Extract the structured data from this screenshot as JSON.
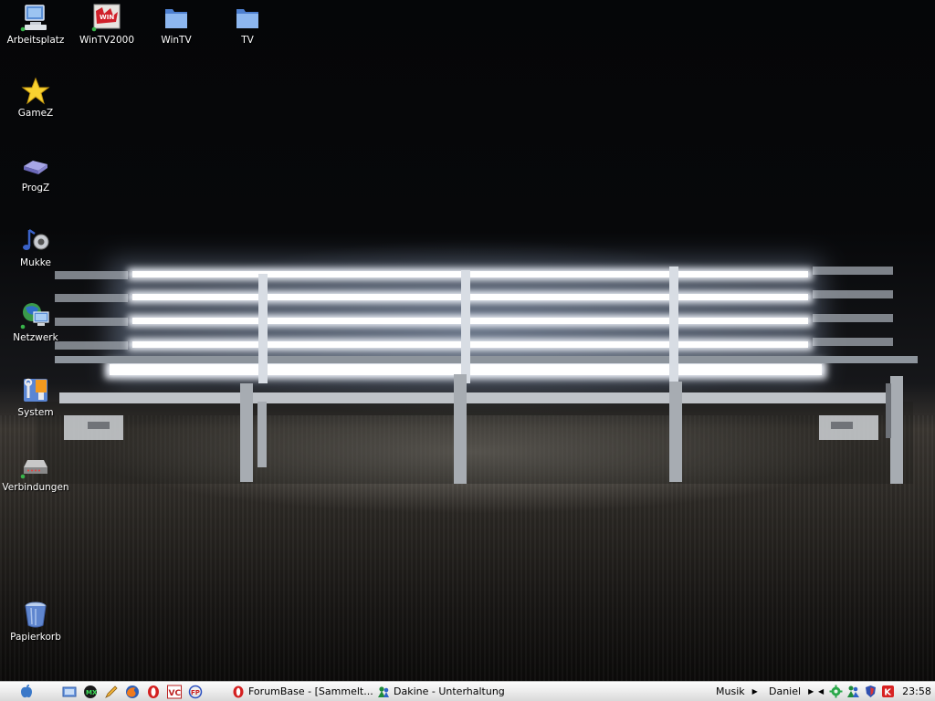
{
  "desktop": {
    "icons": [
      {
        "label": "Arbeitsplatz",
        "icon": "my-computer-icon"
      },
      {
        "label": "WinTV2000",
        "icon": "wintv-app-icon"
      },
      {
        "label": "WinTV",
        "icon": "folder-icon"
      },
      {
        "label": "TV",
        "icon": "folder-icon"
      },
      {
        "label": "GameZ",
        "icon": "star-icon"
      },
      {
        "label": "ProgZ",
        "icon": "drive-icon"
      },
      {
        "label": "Mukke",
        "icon": "music-speaker-icon"
      },
      {
        "label": "Netzwerk",
        "icon": "network-globe-icon"
      },
      {
        "label": "System",
        "icon": "system-tools-icon"
      },
      {
        "label": "Verbindungen",
        "icon": "modem-icon"
      },
      {
        "label": "Papierkorb",
        "icon": "recycle-bin-icon"
      }
    ]
  },
  "taskbar": {
    "start": {
      "icon": "apple-logo-icon"
    },
    "quick_launch": [
      {
        "icon": "show-desktop-icon"
      },
      {
        "icon": "winamp-mx-icon"
      },
      {
        "icon": "pencil-tool-icon"
      },
      {
        "icon": "firefox-icon"
      },
      {
        "icon": "opera-icon"
      },
      {
        "icon": "vc-app-icon"
      },
      {
        "icon": "p2p-app-icon"
      }
    ],
    "tasks": [
      {
        "label": "ForumBase - [Sammelt...",
        "icon": "opera-icon"
      },
      {
        "label": "Dakine - Unterhaltung",
        "icon": "messenger-icon"
      }
    ],
    "toolbars": [
      {
        "label": "Musik"
      },
      {
        "label": "Daniel"
      }
    ],
    "tray": {
      "icons": [
        "green-gear-icon",
        "messenger-status-icon",
        "security-shield-icon",
        "antivirus-icon"
      ],
      "clock": "23:58"
    }
  },
  "colors": {
    "taskbar_bg": "#ececec",
    "desktop_bg": "#050608",
    "light_glow": "#f4f8ff"
  }
}
